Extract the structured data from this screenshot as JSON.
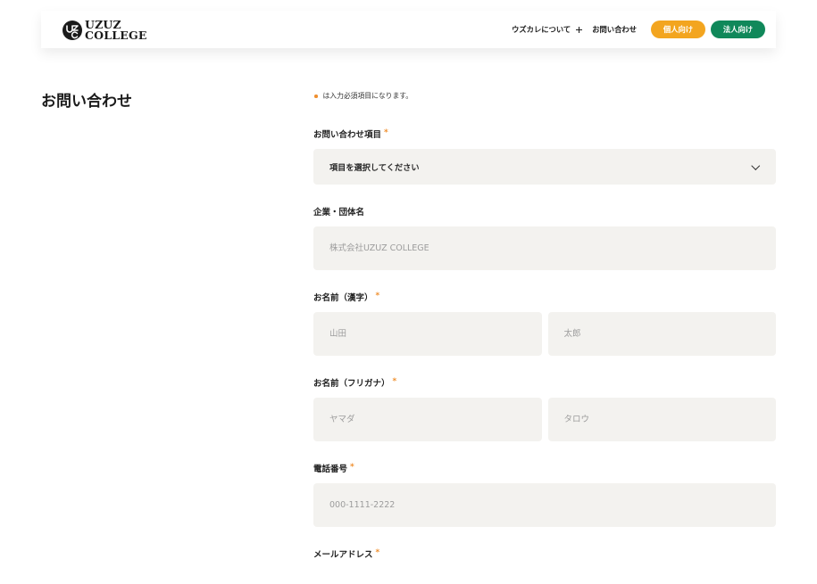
{
  "colors": {
    "orange": "#f3a51f",
    "green": "#10885a",
    "req": "#ef8f2f",
    "field-bg": "#f3f2ef"
  },
  "header": {
    "logo": {
      "icon": "uzuz-college-logo-icon",
      "line1": "UZUZ",
      "line2": "COLLEGE"
    },
    "nav": {
      "about_label": "ウズカレについて",
      "about_icon": "plus-icon",
      "contact_label": "お問い合わせ",
      "individual_button": "個人向け",
      "corporate_button": "法人向け"
    }
  },
  "page_title": "お問い合わせ",
  "form": {
    "required_note": "は入力必須項目になります。",
    "required_mark": "*",
    "inquiry_type": {
      "label": "お問い合わせ項目",
      "selected": "項目を選択してください",
      "icon": "chevron-down-icon"
    },
    "company": {
      "label": "企業・団体名",
      "placeholder": "株式会社UZUZ COLLEGE"
    },
    "name_kanji": {
      "label": "お名前（漢字）",
      "last_placeholder": "山田",
      "first_placeholder": "太郎"
    },
    "name_kana": {
      "label": "お名前（フリガナ）",
      "last_placeholder": "ヤマダ",
      "first_placeholder": "タロウ"
    },
    "phone": {
      "label": "電話番号",
      "placeholder": "000-1111-2222"
    },
    "email": {
      "label": "メールアドレス"
    }
  }
}
